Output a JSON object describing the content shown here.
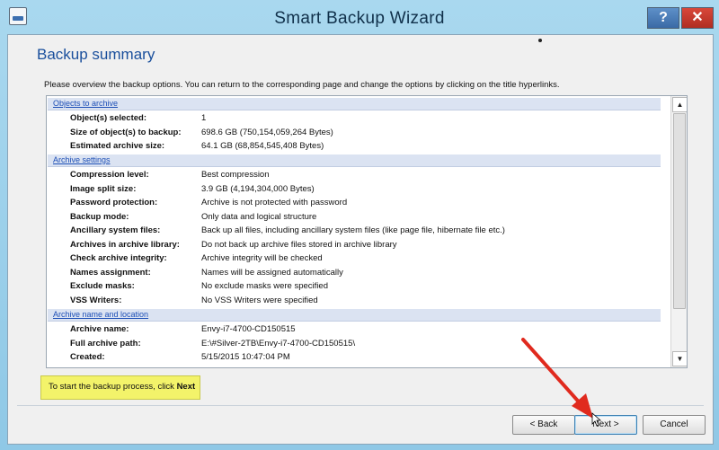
{
  "window": {
    "title": "Smart Backup Wizard",
    "help_label": "?",
    "close_label": "✕"
  },
  "page": {
    "heading": "Backup summary",
    "intro": "Please overview the backup options. You can return to the corresponding page and change the options by clicking on the title hyperlinks."
  },
  "sections": [
    {
      "title": "Objects to archive",
      "rows": [
        {
          "label": "Object(s) selected:",
          "value": "1"
        },
        {
          "label": "Size of object(s) to backup:",
          "value": "698.6 GB (750,154,059,264 Bytes)"
        },
        {
          "label": "Estimated archive size:",
          "value": "64.1 GB (68,854,545,408 Bytes)"
        }
      ]
    },
    {
      "title": "Archive settings",
      "rows": [
        {
          "label": "Compression level:",
          "value": "Best compression"
        },
        {
          "label": "Image split size:",
          "value": "3.9 GB (4,194,304,000 Bytes)"
        },
        {
          "label": "Password protection:",
          "value": "Archive is not protected with password"
        },
        {
          "label": "Backup mode:",
          "value": "Only data and logical structure"
        },
        {
          "label": "Ancillary system files:",
          "value": "Back up all files, including ancillary system files (like page file, hibernate file etc.)"
        },
        {
          "label": "Archives in archive library:",
          "value": "Do not back up archive files stored in archive library"
        },
        {
          "label": "Check archive integrity:",
          "value": "Archive integrity will be checked"
        },
        {
          "label": "Names assignment:",
          "value": "Names will be assigned automatically"
        },
        {
          "label": "Exclude masks:",
          "value": "No exclude masks were specified"
        },
        {
          "label": "VSS Writers:",
          "value": "No VSS Writers were specified"
        }
      ]
    },
    {
      "title": "Archive name and location",
      "rows": [
        {
          "label": "Archive name:",
          "value": "Envy-i7-4700-CD150515"
        },
        {
          "label": "Full archive path:",
          "value": "E:\\#Silver-2TB\\Envy-i7-4700-CD150515\\"
        },
        {
          "label": "Created:",
          "value": "5/15/2015 10:47:04 PM"
        }
      ]
    }
  ],
  "hint": {
    "text": "To start the backup process, click ",
    "emphasis": "Next"
  },
  "buttons": {
    "back": "< Back",
    "next": "Next >",
    "cancel": "Cancel"
  },
  "scrollbar": {
    "up_icon": "▲",
    "down_icon": "▼"
  },
  "colors": {
    "link": "#1d4fb6",
    "heading": "#1a4f9c",
    "hint_bg": "#f3f36a",
    "annotation_arrow": "#e02a1e"
  }
}
